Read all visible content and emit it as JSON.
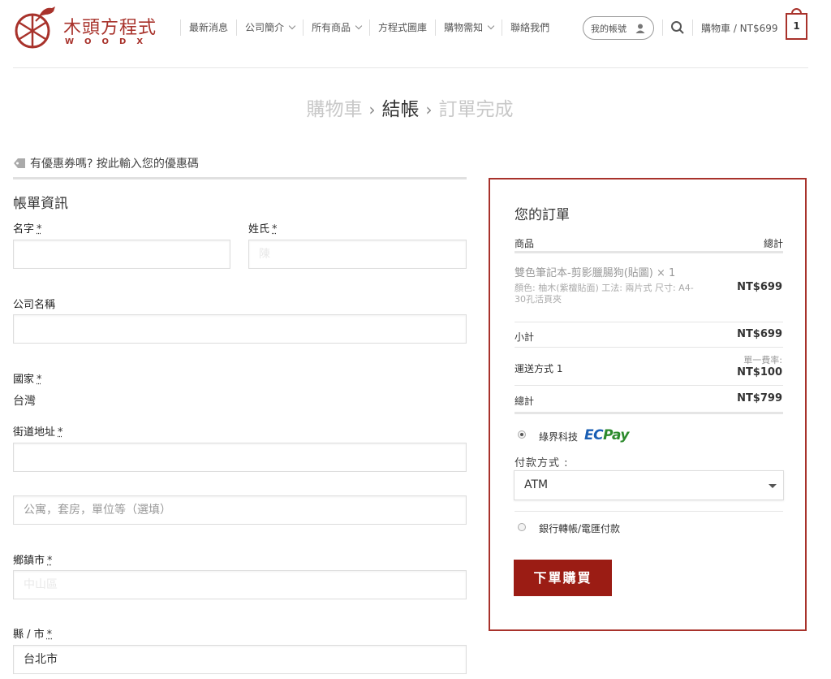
{
  "brand": {
    "name_cn": "木頭方程式",
    "name_en": "WOODX"
  },
  "nav": {
    "items": [
      {
        "label": "最新消息",
        "dropdown": false
      },
      {
        "label": "公司簡介",
        "dropdown": true
      },
      {
        "label": "所有商品",
        "dropdown": true
      },
      {
        "label": "方程式圖庫",
        "dropdown": false
      },
      {
        "label": "購物需知",
        "dropdown": true
      },
      {
        "label": "聯絡我們",
        "dropdown": false
      }
    ],
    "account_label": "我的帳號",
    "cart_label": "購物車 / NT$699",
    "cart_count": "1"
  },
  "steps": {
    "cart": "購物車",
    "checkout": "結帳",
    "complete": "訂單完成",
    "separator": "›"
  },
  "coupon": {
    "text": "有優惠券嗎? 按此輸入您的優惠碼"
  },
  "billing": {
    "title": "帳單資訊",
    "first_name": {
      "label": "名字",
      "required": "*",
      "value": ""
    },
    "last_name": {
      "label": "姓氏",
      "required": "*",
      "placeholder": "陳"
    },
    "company": {
      "label": "公司名稱",
      "value": ""
    },
    "country": {
      "label": "國家",
      "required": "*",
      "value": "台灣"
    },
    "street": {
      "label": "街道地址",
      "required": "*",
      "value": "",
      "placeholder2": "公寓，套房，單位等（選填）"
    },
    "town": {
      "label": "鄉鎮市",
      "required": "*",
      "placeholder": "中山區"
    },
    "state": {
      "label": "縣 / 市",
      "required": "*",
      "value": "台北市"
    }
  },
  "order": {
    "title": "您的訂單",
    "col_product": "商品",
    "col_total": "總計",
    "item": {
      "name": "雙色筆記本-剪影臘腸狗(貼圖)  × 1",
      "meta": "顏色: 柚木(紫檀貼面) 工法: 兩片式 尺寸: A4-30孔活頁夾",
      "price": "NT$699"
    },
    "subtotal_label": "小計",
    "subtotal": "NT$699",
    "shipping_label": "運送方式 1",
    "shipping_note": "單一費率:",
    "shipping": "NT$100",
    "total_label": "總計",
    "total": "NT$799",
    "payment": {
      "option1": "綠界科技",
      "ecpay_ec": "EC",
      "ecpay_pay": "Pay",
      "method_label": "付款方式 :",
      "method_value": "ATM",
      "option2": "銀行轉帳/電匯付款"
    },
    "submit": "下單購買"
  }
}
